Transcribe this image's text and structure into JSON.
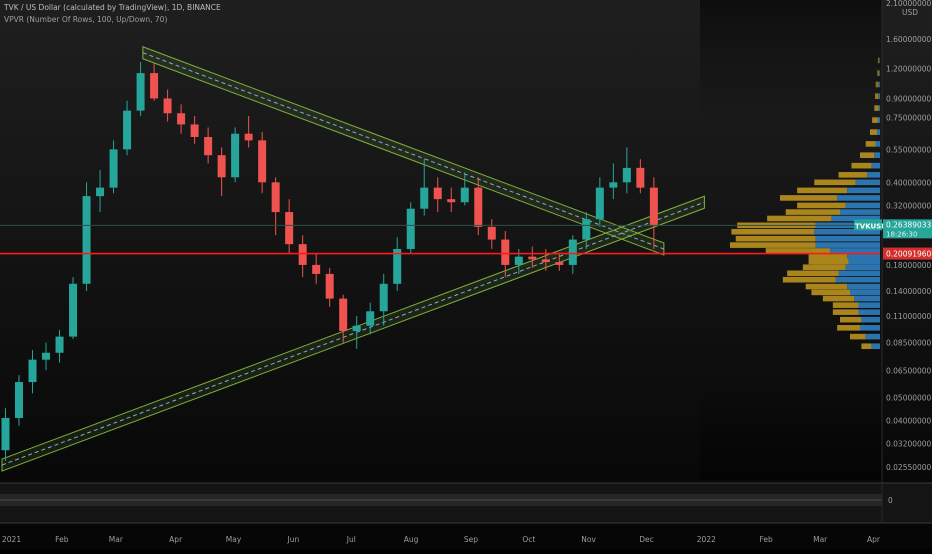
{
  "header": {
    "title": "TVK / US Dollar (calculated by TradingView), 1D, BINANCE",
    "indicator": "VPVR (Number Of Rows, 100, Up/Down, 70)"
  },
  "price_axis": {
    "currency": "USD",
    "top_value": "2.10000000",
    "ticks": [
      "1.60000000",
      "1.20000000",
      "0.90000000",
      "0.75000000",
      "0.55000000",
      "0.40000000",
      "0.32000000",
      "0.26000000",
      "0.18000000",
      "0.14000000",
      "0.11000000",
      "0.08500000",
      "0.06500000",
      "0.05000000",
      "0.04000000",
      "0.03200000",
      "0.02550000"
    ]
  },
  "time_axis": {
    "labels": [
      "2021",
      "Feb",
      "Mar",
      "Apr",
      "May",
      "Jun",
      "Jul",
      "Aug",
      "Sep",
      "Oct",
      "Nov",
      "Dec",
      "2022",
      "Feb",
      "Mar",
      "Apr"
    ]
  },
  "price_tag": {
    "symbol": "TVKUSD",
    "price": "0.26389033",
    "countdown": "18:26:30"
  },
  "level_tag": {
    "price": "0.20091960"
  },
  "sub_pane": {
    "tick": "0"
  },
  "colors": {
    "background": "#000000",
    "up_candle": "#26a69a",
    "down_candle": "#ef5350",
    "channel_green": "#7cb342",
    "support_line": "#ff1a1a",
    "vp_up": "#2f7fc1",
    "vp_down": "#c49a1f",
    "price_tag": "#26a69a"
  },
  "chart_data": {
    "type": "candlestick",
    "symbol": "TVKUSD",
    "interval": "1D",
    "exchange": "BINANCE",
    "y_scale": "log",
    "ylim": [
      0.0225,
      2.2
    ],
    "x_range": [
      "2021-01-01",
      "2022-04-01"
    ],
    "ohlc_weekly": [
      [
        "2021-01-01",
        0.03,
        0.045,
        0.027,
        0.041
      ],
      [
        "2021-01-08",
        0.041,
        0.062,
        0.038,
        0.058
      ],
      [
        "2021-01-15",
        0.058,
        0.079,
        0.052,
        0.072
      ],
      [
        "2021-01-22",
        0.072,
        0.085,
        0.065,
        0.077
      ],
      [
        "2021-01-29",
        0.077,
        0.096,
        0.07,
        0.09
      ],
      [
        "2021-02-05",
        0.09,
        0.16,
        0.088,
        0.15
      ],
      [
        "2021-02-12",
        0.15,
        0.4,
        0.14,
        0.35
      ],
      [
        "2021-02-19",
        0.35,
        0.45,
        0.3,
        0.38
      ],
      [
        "2021-02-26",
        0.38,
        0.6,
        0.36,
        0.55
      ],
      [
        "2021-03-05",
        0.55,
        0.88,
        0.52,
        0.8
      ],
      [
        "2021-03-12",
        0.8,
        1.28,
        0.76,
        1.15
      ],
      [
        "2021-03-19",
        1.15,
        1.26,
        0.88,
        0.9
      ],
      [
        "2021-03-26",
        0.9,
        0.98,
        0.72,
        0.78
      ],
      [
        "2021-04-02",
        0.78,
        0.85,
        0.64,
        0.7
      ],
      [
        "2021-04-09",
        0.7,
        0.76,
        0.58,
        0.62
      ],
      [
        "2021-04-16",
        0.62,
        0.68,
        0.48,
        0.52
      ],
      [
        "2021-04-23",
        0.52,
        0.56,
        0.35,
        0.42
      ],
      [
        "2021-04-30",
        0.42,
        0.68,
        0.4,
        0.64
      ],
      [
        "2021-05-07",
        0.64,
        0.76,
        0.56,
        0.6
      ],
      [
        "2021-05-14",
        0.6,
        0.65,
        0.36,
        0.4
      ],
      [
        "2021-05-21",
        0.4,
        0.42,
        0.24,
        0.3
      ],
      [
        "2021-05-28",
        0.3,
        0.34,
        0.2,
        0.22
      ],
      [
        "2021-06-04",
        0.22,
        0.24,
        0.16,
        0.18
      ],
      [
        "2021-06-11",
        0.18,
        0.2,
        0.15,
        0.165
      ],
      [
        "2021-06-18",
        0.165,
        0.175,
        0.12,
        0.13
      ],
      [
        "2021-06-25",
        0.13,
        0.135,
        0.085,
        0.095
      ],
      [
        "2021-07-02",
        0.095,
        0.11,
        0.08,
        0.1
      ],
      [
        "2021-07-09",
        0.1,
        0.125,
        0.092,
        0.115
      ],
      [
        "2021-07-16",
        0.115,
        0.165,
        0.1,
        0.15
      ],
      [
        "2021-07-23",
        0.15,
        0.235,
        0.14,
        0.21
      ],
      [
        "2021-07-30",
        0.21,
        0.33,
        0.2,
        0.31
      ],
      [
        "2021-08-06",
        0.31,
        0.5,
        0.29,
        0.38
      ],
      [
        "2021-08-13",
        0.38,
        0.42,
        0.3,
        0.34
      ],
      [
        "2021-08-20",
        0.34,
        0.38,
        0.3,
        0.33
      ],
      [
        "2021-08-27",
        0.33,
        0.44,
        0.32,
        0.38
      ],
      [
        "2021-09-03",
        0.38,
        0.42,
        0.24,
        0.26
      ],
      [
        "2021-09-10",
        0.26,
        0.28,
        0.21,
        0.23
      ],
      [
        "2021-09-17",
        0.23,
        0.25,
        0.16,
        0.18
      ],
      [
        "2021-09-24",
        0.18,
        0.21,
        0.165,
        0.195
      ],
      [
        "2021-10-01",
        0.195,
        0.215,
        0.175,
        0.19
      ],
      [
        "2021-10-08",
        0.19,
        0.21,
        0.17,
        0.185
      ],
      [
        "2021-10-15",
        0.185,
        0.2,
        0.17,
        0.18
      ],
      [
        "2021-10-22",
        0.18,
        0.24,
        0.165,
        0.23
      ],
      [
        "2021-10-29",
        0.23,
        0.3,
        0.21,
        0.28
      ],
      [
        "2021-11-05",
        0.28,
        0.42,
        0.26,
        0.38
      ],
      [
        "2021-11-12",
        0.38,
        0.48,
        0.34,
        0.4
      ],
      [
        "2021-11-19",
        0.4,
        0.56,
        0.36,
        0.46
      ],
      [
        "2021-11-26",
        0.46,
        0.5,
        0.36,
        0.38
      ],
      [
        "2021-12-03",
        0.38,
        0.42,
        0.21,
        0.264
      ]
    ],
    "trendlines": [
      {
        "from": [
          "2021-03-15",
          1.4
        ],
        "to": [
          "2021-12-10",
          0.21
        ]
      },
      {
        "from": [
          "2021-01-01",
          0.026
        ],
        "to": [
          "2021-12-31",
          0.33
        ]
      }
    ],
    "horizontal_levels": [
      0.2009196,
      0.26389033
    ],
    "volume_profile": {
      "rows_per_indicator": 100,
      "levels": [
        0.082,
        0.09,
        0.098,
        0.106,
        0.114,
        0.122,
        0.13,
        0.138,
        0.146,
        0.156,
        0.166,
        0.176,
        0.186,
        0.196,
        0.206,
        0.218,
        0.232,
        0.248,
        0.264,
        0.282,
        0.3,
        0.32,
        0.344,
        0.37,
        0.4,
        0.43,
        0.47,
        0.52,
        0.58,
        0.65,
        0.73,
        0.82,
        0.92,
        1.03,
        1.15,
        1.3
      ],
      "up": [
        12,
        20,
        28,
        26,
        30,
        30,
        36,
        42,
        46,
        62,
        58,
        48,
        44,
        46,
        70,
        90,
        90,
        92,
        90,
        68,
        56,
        48,
        60,
        46,
        34,
        18,
        12,
        8,
        6,
        4,
        3,
        2,
        2,
        2,
        1,
        1
      ],
      "down": [
        14,
        22,
        32,
        30,
        36,
        36,
        44,
        54,
        58,
        74,
        72,
        60,
        56,
        54,
        90,
        120,
        112,
        116,
        110,
        90,
        76,
        68,
        80,
        70,
        58,
        40,
        28,
        20,
        14,
        10,
        8,
        6,
        5,
        4,
        3,
        2
      ]
    }
  }
}
